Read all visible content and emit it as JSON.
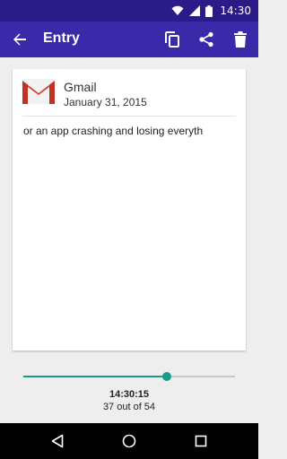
{
  "status_bar": {
    "time": "14:30"
  },
  "app_bar": {
    "title": "Entry"
  },
  "entry": {
    "app_name": "Gmail",
    "date": "January 31, 2015",
    "text": "or an app crashing and losing everyth"
  },
  "timeline": {
    "position_fraction": 0.68,
    "time": "14:30:15",
    "count": "37 out of 54"
  },
  "colors": {
    "status_bar": "#2a1b86",
    "app_bar": "#3a2aa9",
    "accent": "#1a9a89",
    "gmail_red": "#d23f31"
  }
}
